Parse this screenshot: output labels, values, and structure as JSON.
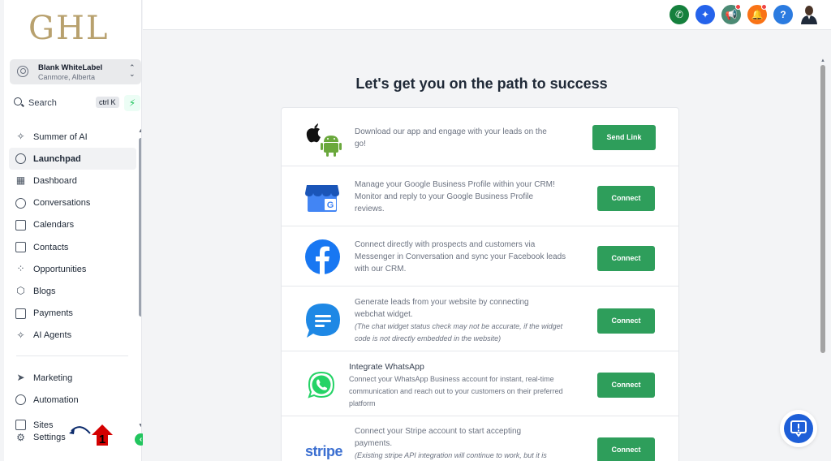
{
  "logo": "GHL",
  "account": {
    "name": "Blank WhiteLabel",
    "location": "Canmore, Alberta"
  },
  "search": {
    "label": "Search",
    "shortcut": "ctrl K"
  },
  "nav": {
    "items": [
      {
        "label": "Summer of AI",
        "icon": "sparkle-icon"
      },
      {
        "label": "Launchpad",
        "icon": "rocket-icon",
        "active": true
      },
      {
        "label": "Dashboard",
        "icon": "dashboard-icon"
      },
      {
        "label": "Conversations",
        "icon": "chat-icon"
      },
      {
        "label": "Calendars",
        "icon": "calendar-icon"
      },
      {
        "label": "Contacts",
        "icon": "contacts-icon"
      },
      {
        "label": "Opportunities",
        "icon": "opportunities-icon"
      },
      {
        "label": "Blogs",
        "icon": "cube-icon"
      },
      {
        "label": "Payments",
        "icon": "payments-icon"
      },
      {
        "label": "AI Agents",
        "icon": "sparkle-icon"
      }
    ],
    "lower": [
      {
        "label": "Marketing",
        "icon": "send-icon"
      },
      {
        "label": "Automation",
        "icon": "automation-icon"
      }
    ],
    "sites": "Sites",
    "settings": "Settings"
  },
  "annotation": {
    "number": "1"
  },
  "page": {
    "title": "Let's get you on the path to success"
  },
  "rows": [
    {
      "id": "app",
      "text": [
        "Download our app and engage with your leads on the",
        "go!"
      ],
      "button": "Send Link"
    },
    {
      "id": "gbp",
      "text": [
        "Manage your Google Business Profile within your CRM!",
        "Monitor and reply to your Google Business Profile",
        "reviews."
      ],
      "button": "Connect"
    },
    {
      "id": "facebook",
      "text": [
        "Connect directly with prospects and customers via",
        "Messenger in Conversation and sync your Facebook leads",
        "with our CRM."
      ],
      "button": "Connect"
    },
    {
      "id": "webchat",
      "text": [
        "Generate leads from your website by connecting",
        "webchat widget."
      ],
      "note": [
        "(The chat widget status check may not be accurate, if the widget",
        "code is not directly embedded in the website)"
      ],
      "button": "Connect"
    },
    {
      "id": "whatsapp",
      "heading": "Integrate WhatsApp",
      "text": [
        "Connect your WhatsApp Business account for instant, real-time",
        "communication and reach out to your customers on their preferred",
        "platform"
      ],
      "button": "Connect"
    },
    {
      "id": "stripe",
      "text": [
        "Connect your Stripe account to start accepting",
        "payments."
      ],
      "note": [
        "(Existing stripe API integration will continue to work, but it is"
      ],
      "button": "Connect",
      "logo": "stripe"
    }
  ],
  "colors": {
    "accent": "#2e9e5b",
    "brand": "#b8a16e"
  }
}
